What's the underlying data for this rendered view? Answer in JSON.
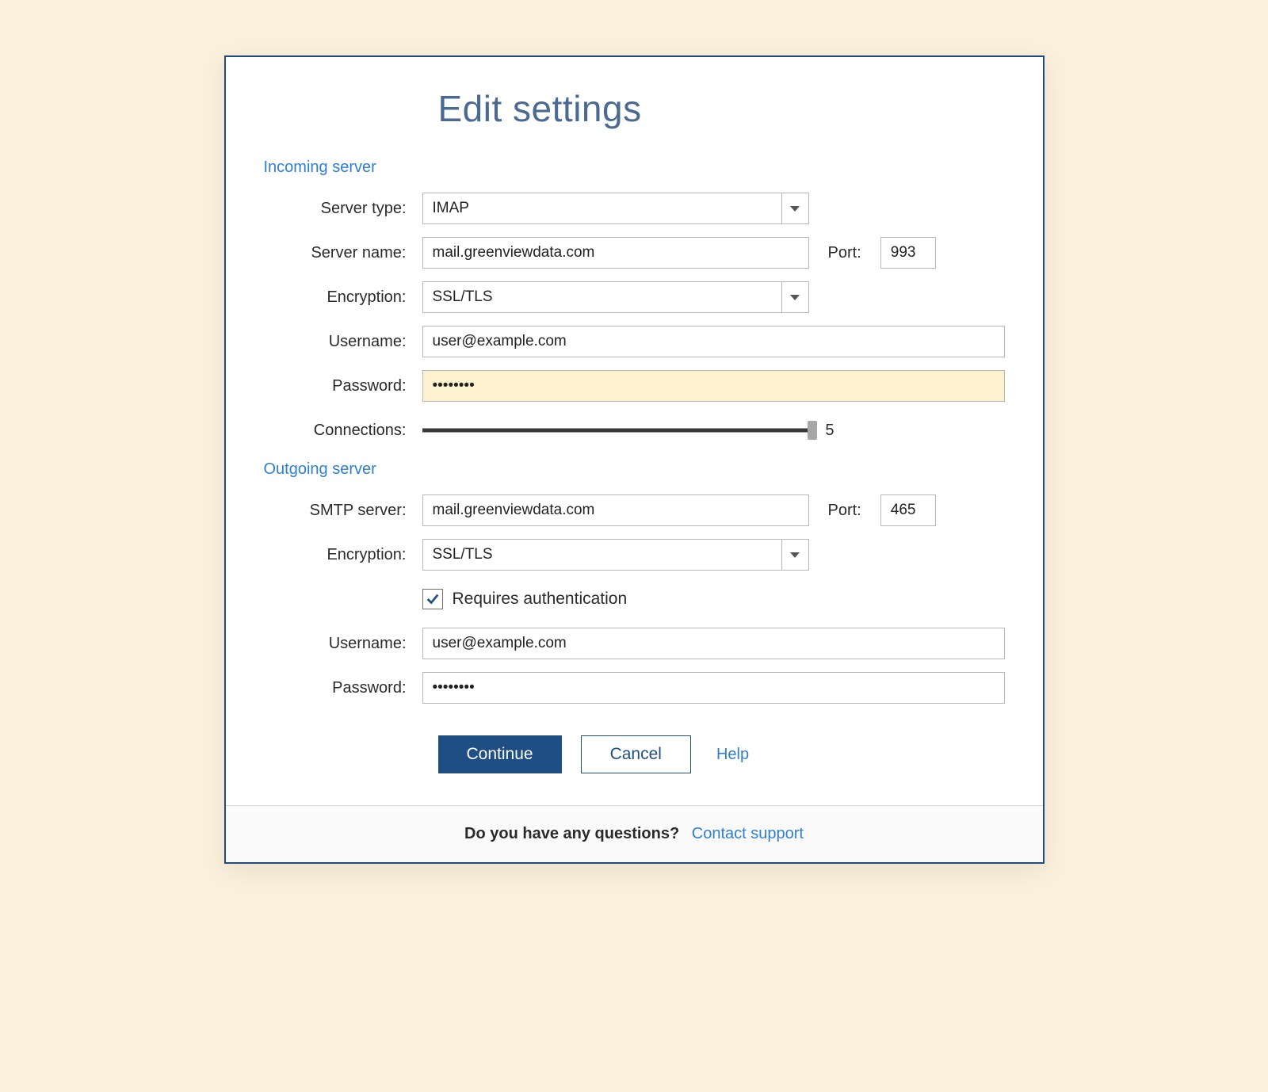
{
  "title": "Edit settings",
  "incoming": {
    "header": "Incoming server",
    "server_type_label": "Server type:",
    "server_type_value": "IMAP",
    "server_name_label": "Server name:",
    "server_name_value": "mail.greenviewdata.com",
    "port_label": "Port:",
    "port_value": "993",
    "encryption_label": "Encryption:",
    "encryption_value": "SSL/TLS",
    "username_label": "Username:",
    "username_value": "user@example.com",
    "password_label": "Password:",
    "password_value": "••••••••",
    "connections_label": "Connections:",
    "connections_value": "5",
    "connections_max": 5
  },
  "outgoing": {
    "header": "Outgoing server",
    "smtp_label": "SMTP server:",
    "smtp_value": "mail.greenviewdata.com",
    "port_label": "Port:",
    "port_value": "465",
    "encryption_label": "Encryption:",
    "encryption_value": "SSL/TLS",
    "requires_auth_label": "Requires authentication",
    "requires_auth_checked": true,
    "username_label": "Username:",
    "username_value": "user@example.com",
    "password_label": "Password:",
    "password_value": "••••••••"
  },
  "buttons": {
    "continue": "Continue",
    "cancel": "Cancel",
    "help": "Help"
  },
  "footer": {
    "question": "Do you have any questions?",
    "support": "Contact support"
  }
}
